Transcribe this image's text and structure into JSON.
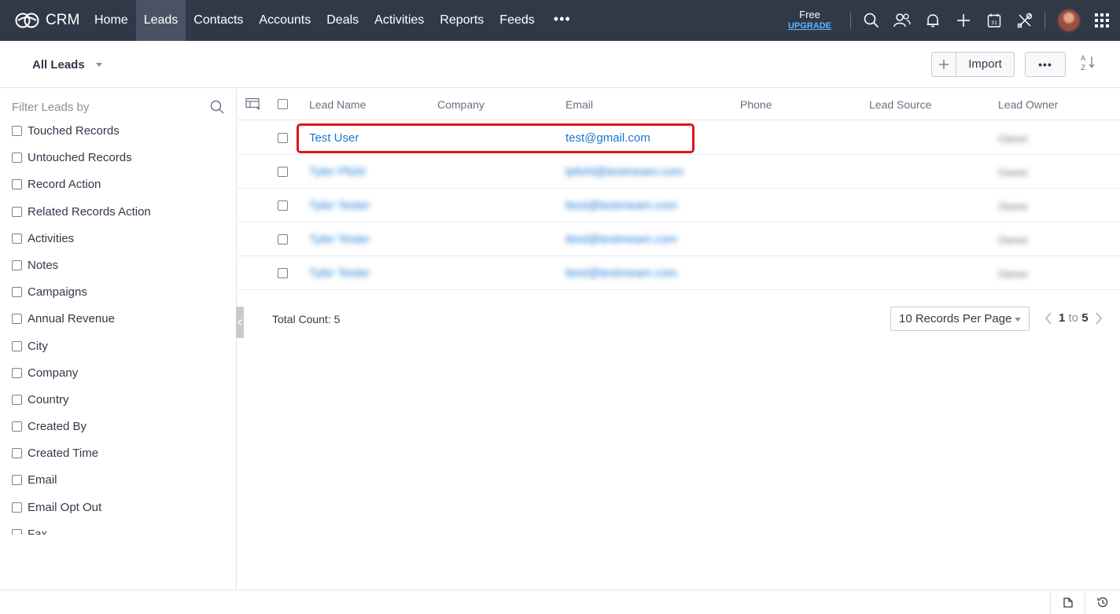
{
  "app": {
    "name": "CRM"
  },
  "nav": {
    "items": [
      {
        "label": "Home",
        "active": false
      },
      {
        "label": "Leads",
        "active": true
      },
      {
        "label": "Contacts",
        "active": false
      },
      {
        "label": "Accounts",
        "active": false
      },
      {
        "label": "Deals",
        "active": false
      },
      {
        "label": "Activities",
        "active": false
      },
      {
        "label": "Reports",
        "active": false
      },
      {
        "label": "Feeds",
        "active": false
      }
    ],
    "more": "•••",
    "plan_label": "Free",
    "upgrade_label": "UPGRADE"
  },
  "subheader": {
    "view_label": "All Leads",
    "import_label": "Import",
    "more_label": "•••"
  },
  "sidebar": {
    "title": "Filter Leads by",
    "filters": [
      "Touched Records",
      "Untouched Records",
      "Record Action",
      "Related Records Action",
      "Activities",
      "Notes",
      "Campaigns",
      "Annual Revenue",
      "City",
      "Company",
      "Country",
      "Created By",
      "Created Time",
      "Email",
      "Email Opt Out",
      "Fax"
    ]
  },
  "table": {
    "columns": [
      "Lead Name",
      "Company",
      "Email",
      "Phone",
      "Lead Source",
      "Lead Owner"
    ],
    "rows": [
      {
        "lead_name": "Test User",
        "email": "test@gmail.com",
        "owner": "Owner",
        "blurred": false
      },
      {
        "lead_name": "Tyler Pfohl",
        "email": "tpfohl@testmeam.com",
        "owner": "Owner",
        "blurred": true
      },
      {
        "lead_name": "Tyler Tester",
        "email": "ttest@testmeam.com",
        "owner": "Owner",
        "blurred": true
      },
      {
        "lead_name": "Tyler Tester",
        "email": "ttest@testmeam.com",
        "owner": "Owner",
        "blurred": true
      },
      {
        "lead_name": "Tyler Tester",
        "email": "ttest@testmeam.com",
        "owner": "Owner",
        "blurred": true
      }
    ],
    "total_count": "Total Count: 5",
    "per_page": "10 Records Per Page",
    "pager": {
      "from": "1",
      "to_word": "to",
      "to": "5"
    }
  },
  "colors": {
    "topnav_bg": "#313949",
    "active_tab_bg": "#4a5363",
    "link": "#1a76d2",
    "highlight": "#e1141c",
    "upgrade": "#5fb3ff"
  }
}
